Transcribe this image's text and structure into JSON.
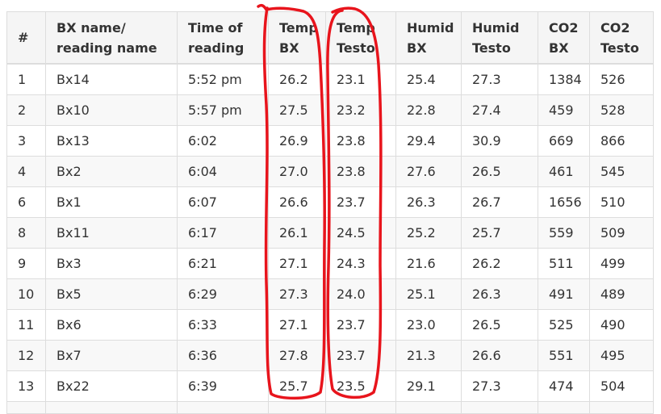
{
  "table": {
    "headers": [
      "#",
      "BX name/ reading name",
      "Time of reading",
      "Temp BX",
      "Temp Testo",
      "Humid BX",
      "Humid Testo",
      "CO2 BX",
      "CO2 Testo"
    ],
    "rows": [
      [
        "1",
        "Bx14",
        "5:52 pm",
        "26.2",
        "23.1",
        "25.4",
        "27.3",
        "1384",
        "526"
      ],
      [
        "2",
        "Bx10",
        "5:57 pm",
        "27.5",
        "23.2",
        "22.8",
        "27.4",
        "459",
        "528"
      ],
      [
        "3",
        "Bx13",
        "6:02",
        "26.9",
        "23.8",
        "29.4",
        "30.9",
        "669",
        "866"
      ],
      [
        "4",
        "Bx2",
        "6:04",
        "27.0",
        "23.8",
        "27.6",
        "26.5",
        "461",
        "545"
      ],
      [
        "6",
        "Bx1",
        "6:07",
        "26.6",
        "23.7",
        "26.3",
        "26.7",
        "1656",
        "510"
      ],
      [
        "8",
        "Bx11",
        "6:17",
        "26.1",
        "24.5",
        "25.2",
        "25.7",
        "559",
        "509"
      ],
      [
        "9",
        "Bx3",
        "6:21",
        "27.1",
        "24.3",
        "21.6",
        "26.2",
        "511",
        "499"
      ],
      [
        "10",
        "Bx5",
        "6:29",
        "27.3",
        "24.0",
        "25.1",
        "26.3",
        "491",
        "489"
      ],
      [
        "11",
        "Bx6",
        "6:33",
        "27.1",
        "23.7",
        "23.0",
        "26.5",
        "525",
        "490"
      ],
      [
        "12",
        "Bx7",
        "6:36",
        "27.8",
        "23.7",
        "21.3",
        "26.6",
        "551",
        "495"
      ],
      [
        "13",
        "Bx22",
        "6:39",
        "25.7",
        "23.5",
        "29.1",
        "27.3",
        "474",
        "504"
      ]
    ]
  },
  "annotation": {
    "color": "#e8141c",
    "highlighted_columns": [
      "Temp BX",
      "Temp Testo"
    ]
  }
}
